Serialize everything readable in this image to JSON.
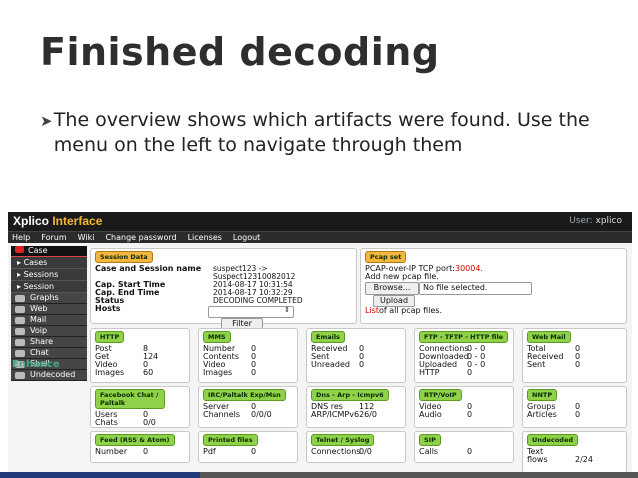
{
  "slide": {
    "title": "Finished decoding",
    "bullet": "The overview shows which artifacts were found. Use the menu on the left to navigate through them"
  },
  "app": {
    "logo_main": "Xplico ",
    "logo_accent": "Interface",
    "user_label": "User:",
    "user_name": "xplico",
    "menu": [
      "Help",
      "Forum",
      "Wiki",
      "Change password",
      "Licenses",
      "Logout"
    ]
  },
  "sidebar": {
    "case": "Case",
    "sub": [
      "Cases",
      "Sessions",
      "Session"
    ],
    "groups": [
      "Graphs",
      "Web",
      "Mail",
      "Voip",
      "Share",
      "Chat",
      "Shell",
      "Undecoded"
    ],
    "enhance": "Enhance"
  },
  "session": {
    "header": "Session Data",
    "rows": [
      {
        "k": "Case and Session name",
        "v": "suspect123 ->"
      },
      {
        "k": "",
        "v": "Suspect12310082012"
      },
      {
        "k": "Cap. Start Time",
        "v": "2014-08-17 10:31:54"
      },
      {
        "k": "Cap. End Time",
        "v": "2014-08-17 10:32:29"
      },
      {
        "k": "Status",
        "v": "DECODING COMPLETED"
      },
      {
        "k": "Hosts",
        "v": ""
      }
    ],
    "filter_button": "Filter"
  },
  "pcap": {
    "header": "Pcap set",
    "line1_prefix": "PCAP-over-IP TCP port: ",
    "line1_port": "30004.",
    "line2": "Add new pcap file.",
    "browse": "Browse...",
    "nofile": "No file selected.",
    "upload": "Upload",
    "list_link": "List",
    "list_rest": " of all pcap files."
  },
  "panels": [
    {
      "title": "HTTP",
      "rows": [
        [
          "Post",
          "8"
        ],
        [
          "Get",
          "124"
        ],
        [
          "Video",
          "0"
        ],
        [
          "Images",
          "60"
        ]
      ]
    },
    {
      "title": "MMS",
      "rows": [
        [
          "Number",
          "0"
        ],
        [
          "Contents",
          "0"
        ],
        [
          "Video",
          "0"
        ],
        [
          "Images",
          "0"
        ]
      ]
    },
    {
      "title": "Emails",
      "rows": [
        [
          "Received",
          "0"
        ],
        [
          "Sent",
          "0"
        ],
        [
          "Unreaded",
          "0"
        ]
      ]
    },
    {
      "title": "FTP - TFTP - HTTP file",
      "rows": [
        [
          "Connections",
          "0 - 0"
        ],
        [
          "Downloaded",
          "0 - 0"
        ],
        [
          "Uploaded",
          "0 - 0"
        ],
        [
          "HTTP",
          "0"
        ]
      ]
    },
    {
      "title": "Web Mail",
      "rows": [
        [
          "Total",
          "0"
        ],
        [
          "Received",
          "0"
        ],
        [
          "Sent",
          "0"
        ]
      ]
    },
    {
      "title": "Facebook Chat / Paltalk",
      "rows": [
        [
          "Users",
          "0"
        ],
        [
          "Chats",
          "0/0"
        ]
      ]
    },
    {
      "title": "IRC/Paltalk Exp/Msn",
      "rows": [
        [
          "Server",
          "0"
        ],
        [
          "Channels",
          "0/0/0"
        ]
      ]
    },
    {
      "title": "Dns - Arp - Icmpv6",
      "rows": [
        [
          "DNS res",
          "112"
        ],
        [
          "ARP/ICMPv6",
          "26/0"
        ]
      ]
    },
    {
      "title": "RTP/VoIP",
      "rows": [
        [
          "Video",
          "0"
        ],
        [
          "Audio",
          "0"
        ]
      ]
    },
    {
      "title": "NNTP",
      "rows": [
        [
          "Groups",
          "0"
        ],
        [
          "Articles",
          "0"
        ]
      ]
    },
    {
      "title": "Feed (RSS & Atom)",
      "rows": [
        [
          "Number",
          "0"
        ]
      ]
    },
    {
      "title": "Printed files",
      "rows": [
        [
          "Pdf",
          "0"
        ]
      ]
    },
    {
      "title": "Telnet / Syslog",
      "rows": [
        [
          "Connections",
          "0/0"
        ]
      ]
    },
    {
      "title": "SIP",
      "rows": [
        [
          "Calls",
          "0"
        ]
      ]
    },
    {
      "title": "Undecoded",
      "rows": [
        [
          "Text",
          ""
        ],
        [
          "flows",
          "2/24"
        ]
      ]
    }
  ]
}
